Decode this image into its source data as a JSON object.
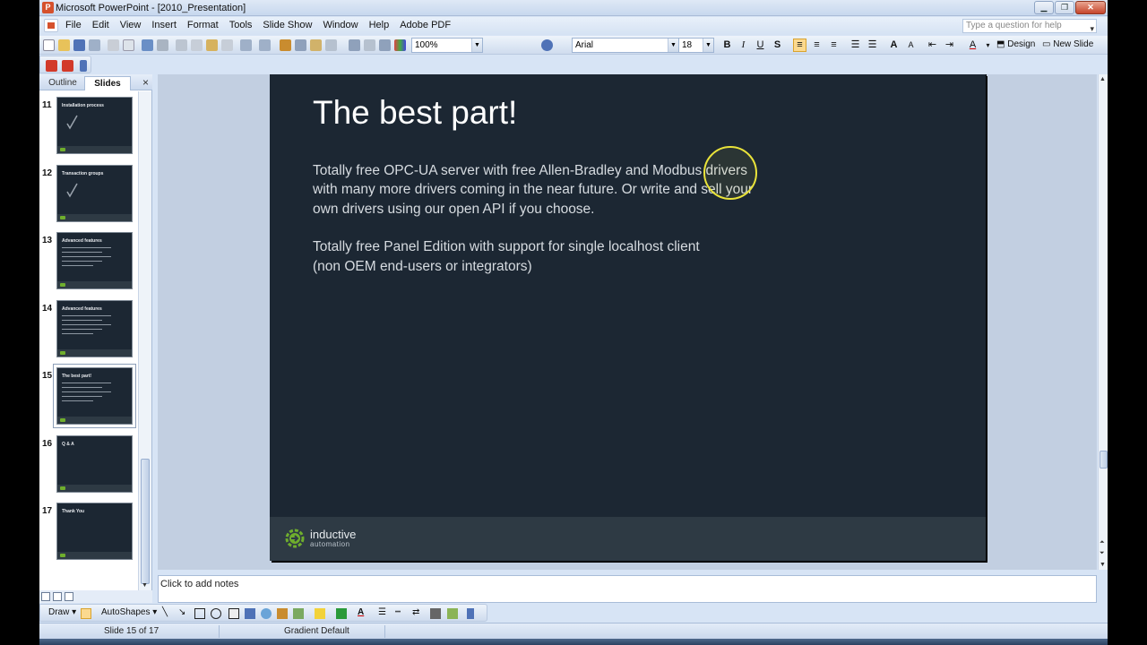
{
  "window": {
    "title": "Microsoft PowerPoint - [2010_Presentation]",
    "app_icon_letter": "P"
  },
  "menu": {
    "items": [
      "File",
      "Edit",
      "View",
      "Insert",
      "Format",
      "Tools",
      "Slide Show",
      "Window",
      "Help",
      "Adobe PDF"
    ],
    "help_placeholder": "Type a question for help"
  },
  "toolbar": {
    "zoom": "100%",
    "font": "Arial",
    "font_size": "18",
    "bold": "B",
    "italic": "I",
    "underline": "U",
    "shadow": "S",
    "design_label": "Design",
    "new_slide_label": "New Slide"
  },
  "panel": {
    "tab_outline": "Outline",
    "tab_slides": "Slides",
    "close": "×",
    "thumbnails": [
      {
        "num": "11",
        "title": "Installation process",
        "check": true,
        "lines": 0
      },
      {
        "num": "12",
        "title": "Transaction groups",
        "check": true,
        "lines": 0
      },
      {
        "num": "13",
        "title": "Advanced features",
        "check": false,
        "lines": 5
      },
      {
        "num": "14",
        "title": "Advanced features",
        "check": false,
        "lines": 5
      },
      {
        "num": "15",
        "title": "The best part!",
        "check": false,
        "lines": 5,
        "selected": true
      },
      {
        "num": "16",
        "title": "Q & A",
        "check": false,
        "lines": 0
      },
      {
        "num": "17",
        "title": "Thank You",
        "check": false,
        "lines": 0
      }
    ]
  },
  "slide": {
    "title": "The best part!",
    "paragraph1": [
      "Totally free OPC-UA server with free Allen-Bradley and Modbus drivers",
      "with many more drivers coming in the near future. Or write and sell your",
      "own drivers using our open API if you choose."
    ],
    "paragraph2": [
      "Totally free Panel Edition with support for single localhost client",
      "(non OEM end-users or integrators)"
    ],
    "logo_line1": "inductive",
    "logo_line2": "automation",
    "colors": {
      "background": "#1c2733",
      "footer": "#2e3a44",
      "accent": "#6fae2d"
    }
  },
  "notes": {
    "placeholder": "Click to add notes"
  },
  "drawing": {
    "draw_label": "Draw",
    "autoshapes_label": "AutoShapes"
  },
  "status": {
    "slide_position": "Slide 15 of 17",
    "design_template": "Gradient Default"
  }
}
